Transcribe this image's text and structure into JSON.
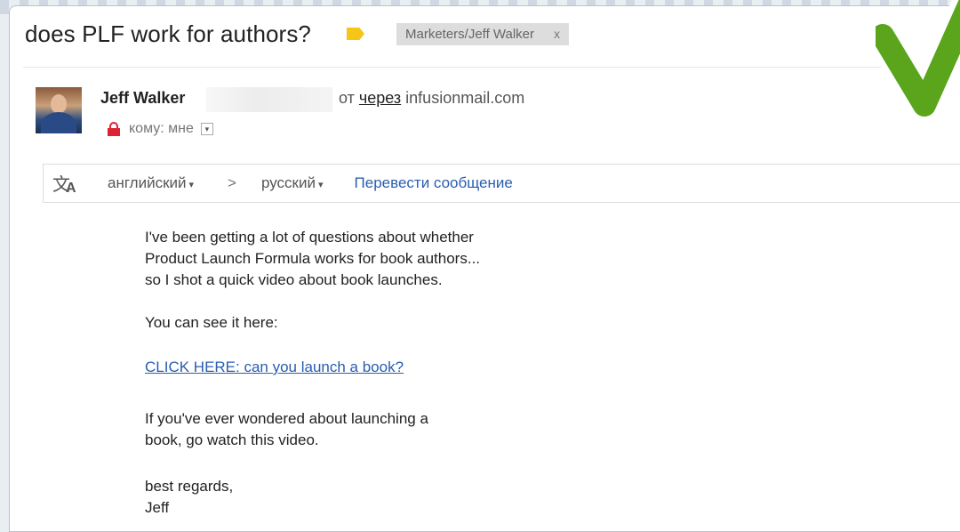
{
  "email": {
    "subject": "does PLF work for authors?",
    "label_tag": "Marketers/Jeff Walker",
    "label_close": "x",
    "sender_name": "Jeff Walker",
    "via_prefix": "от",
    "via_word": "через",
    "via_domain": "infusionmail.com",
    "recipient_text": "кому: мне",
    "recipient_dropdown": "▾"
  },
  "translate": {
    "source_lang": "английский",
    "target_lang": "русский",
    "arrow": ">",
    "caret": "▾",
    "action": "Перевести сообщение"
  },
  "message": {
    "p1_line1": "I've been getting a lot of questions about whether",
    "p1_line2": "Product Launch Formula works for book authors...",
    "p1_line3": "so I shot a quick video about book launches.",
    "p2": "You can see it here:",
    "link": "CLICK HERE: can you launch a book?",
    "p3_line1": "If you've ever wondered about launching a",
    "p3_line2": "book, go watch this video.",
    "signoff": "best regards,",
    "signature": "Jeff"
  },
  "colors": {
    "label_yellow": "#f5c518",
    "link_blue": "#2a5db0",
    "lock_red": "#dd2233",
    "check_green": "#5aa51c"
  }
}
